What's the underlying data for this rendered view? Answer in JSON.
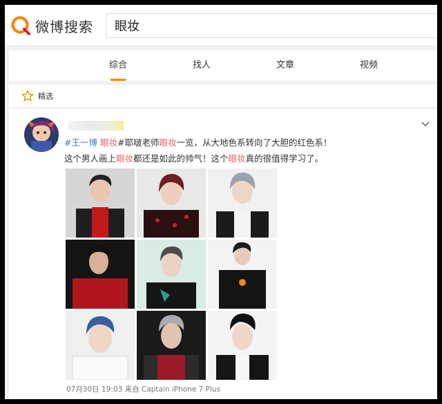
{
  "header": {
    "logo_text": "微博搜索",
    "logo_icon": "search-q-icon",
    "search_value": "眼妆"
  },
  "tabs": [
    {
      "label": "综合",
      "active": true
    },
    {
      "label": "找人",
      "active": false
    },
    {
      "label": "文章",
      "active": false
    },
    {
      "label": "视频",
      "active": false
    }
  ],
  "filter": {
    "label": "精选",
    "icon": "star-icon"
  },
  "post": {
    "line1": [
      {
        "text": "#王一博",
        "style": "topic"
      },
      {
        "text": " 眼妆",
        "style": "kw"
      },
      {
        "text": "#耶啵老师",
        "style": "normal"
      },
      {
        "text": "眼妆",
        "style": "kw"
      },
      {
        "text": "一览，从大地色系转向了大胆的红色系！",
        "style": "normal"
      }
    ],
    "line2": [
      {
        "text": "这个男人画上",
        "style": "normal"
      },
      {
        "text": "眼妆",
        "style": "kw"
      },
      {
        "text": "都还是如此的帅气！这个",
        "style": "normal"
      },
      {
        "text": "眼妆",
        "style": "kw"
      },
      {
        "text": "真的很值得学习了。",
        "style": "normal"
      }
    ],
    "meta": "07月30日 19:03 来自 Captain iPhone 7 Plus",
    "photo_count": 9
  },
  "colors": {
    "accent": "#ff8200",
    "topic": "#3c7cc1",
    "keyword": "#e8606f"
  }
}
